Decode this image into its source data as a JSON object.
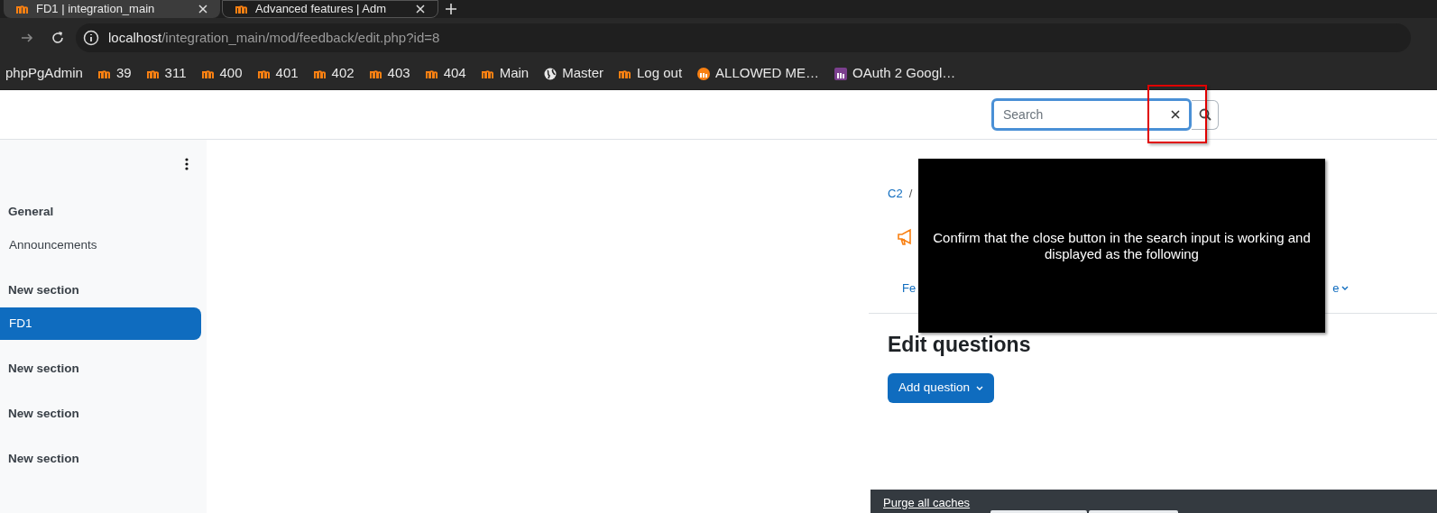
{
  "browser": {
    "tabs": [
      {
        "title": "FD1 | integration_main",
        "selected": true
      },
      {
        "title": "Advanced features | Adm",
        "selected": false
      }
    ],
    "url": {
      "host": "localhost",
      "path": "/integration_main/mod/feedback/edit.php?id=8"
    },
    "bookmarks": [
      {
        "label": "phpPgAdmin",
        "kind": "none"
      },
      {
        "label": "39",
        "kind": "moodle"
      },
      {
        "label": "311",
        "kind": "moodle"
      },
      {
        "label": "400",
        "kind": "moodle"
      },
      {
        "label": "401",
        "kind": "moodle"
      },
      {
        "label": "402",
        "kind": "moodle"
      },
      {
        "label": "403",
        "kind": "moodle"
      },
      {
        "label": "404",
        "kind": "moodle"
      },
      {
        "label": "Main",
        "kind": "moodle"
      },
      {
        "label": "Master",
        "kind": "globe"
      },
      {
        "label": "Log out",
        "kind": "moodle"
      },
      {
        "label": "ALLOWED ME…",
        "kind": "circle"
      },
      {
        "label": "OAuth 2 Googl…",
        "kind": "square"
      }
    ]
  },
  "header": {
    "search": {
      "placeholder": "Search"
    }
  },
  "sidebar": {
    "items": [
      {
        "label": "General",
        "kind": "section",
        "selected": false
      },
      {
        "label": "Announcements",
        "kind": "activity",
        "selected": false
      },
      {
        "label": "New section",
        "kind": "section",
        "selected": false
      },
      {
        "label": "FD1",
        "kind": "activity",
        "selected": true
      },
      {
        "label": "New section",
        "kind": "section",
        "selected": false
      },
      {
        "label": "New section",
        "kind": "section",
        "selected": false
      },
      {
        "label": "New section",
        "kind": "section",
        "selected": false
      }
    ]
  },
  "content": {
    "breadcrumb": [
      "C2",
      "/"
    ],
    "nav_left": "Fe",
    "nav_right": "e",
    "heading": "Edit questions",
    "add_button": "Add question"
  },
  "overlay": {
    "message": "Confirm that the close button in the search input is working and displayed as the following"
  },
  "footer": {
    "link": "Purge all caches"
  }
}
